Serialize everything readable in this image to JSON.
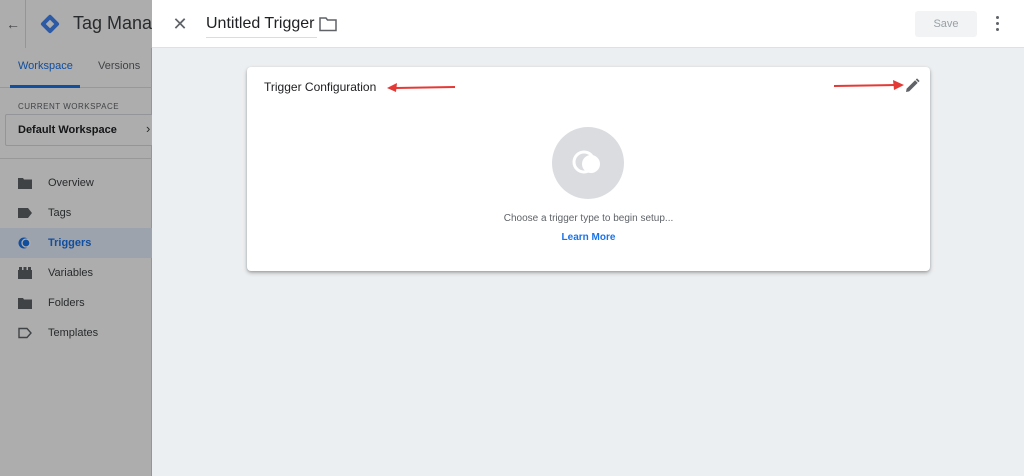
{
  "app": {
    "title": "Tag Manager"
  },
  "sidebar": {
    "tabs": [
      {
        "label": "Workspace"
      },
      {
        "label": "Versions"
      }
    ],
    "workspace_label": "CURRENT WORKSPACE",
    "workspace_name": "Default Workspace",
    "items": [
      {
        "label": "Overview",
        "icon": "overview-icon"
      },
      {
        "label": "Tags",
        "icon": "tag-icon"
      },
      {
        "label": "Triggers",
        "icon": "trigger-icon",
        "active": true
      },
      {
        "label": "Variables",
        "icon": "variables-icon"
      },
      {
        "label": "Folders",
        "icon": "folder-icon"
      },
      {
        "label": "Templates",
        "icon": "template-icon"
      }
    ]
  },
  "panel": {
    "name": "Untitled Trigger",
    "save_label": "Save"
  },
  "card": {
    "title": "Trigger Configuration",
    "prompt": "Choose a trigger type to begin setup...",
    "learn_more": "Learn More"
  },
  "colors": {
    "accent": "#1a73e8",
    "annotation": "#e53935",
    "logo_blue": "#4285f4",
    "logo_dark": "#1967d2"
  }
}
